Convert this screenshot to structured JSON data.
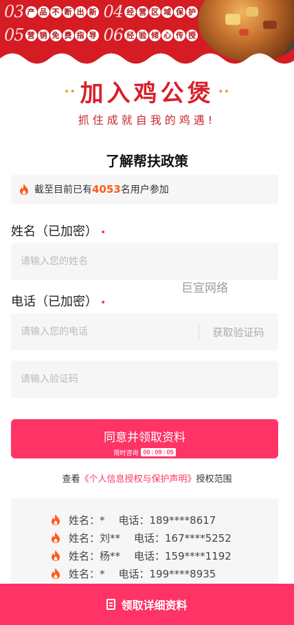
{
  "banner": {
    "features": [
      {
        "num": "03",
        "text": "产品不断出新"
      },
      {
        "num": "04",
        "text": "经营区域保护"
      },
      {
        "num": "05",
        "text": "营销免费指导"
      },
      {
        "num": "06",
        "text": "经验倾心传授"
      }
    ],
    "color": "#d41c22"
  },
  "brand": {
    "title": "加入鸡公煲",
    "dots_left": "··",
    "dots_right": "··",
    "slogan": "抓住成就自我的鸡遇!"
  },
  "section_title": "了解帮扶政策",
  "counter": {
    "prefix": "截至目前已有",
    "count": "4053",
    "suffix": "名用户参加",
    "icon": "flame-icon"
  },
  "form": {
    "name_label": "姓名（已加密）",
    "name_placeholder": "请输入您的姓名",
    "phone_label": "电话（已加密）",
    "phone_placeholder": "请输入您的电话",
    "get_code": "获取验证码",
    "code_placeholder": "请输入验证码",
    "required_mark": "•"
  },
  "watermark": "巨宣网络",
  "submit": {
    "label": "同意并领取资料",
    "timer_label": "限时咨询",
    "h": "00",
    "m": "09",
    "s": "05",
    "sep": ":"
  },
  "policy": {
    "prefix": "查看",
    "link": "《个人信息授权与保护声明》",
    "suffix": "授权范围"
  },
  "list": [
    {
      "name": "姓名：*",
      "phone": "电话：189****8617"
    },
    {
      "name": "姓名：刘**",
      "phone": "电话：167****5252"
    },
    {
      "name": "姓名：杨**",
      "phone": "电话：159****1192"
    },
    {
      "name": "姓名：*",
      "phone": "电话：199****8935"
    }
  ],
  "bottom_bar": {
    "label": "领取详细资料",
    "icon": "document-icon"
  },
  "colors": {
    "accent": "#ff3366",
    "brand_red": "#d8202a",
    "count_orange": "#ff5a1f"
  }
}
